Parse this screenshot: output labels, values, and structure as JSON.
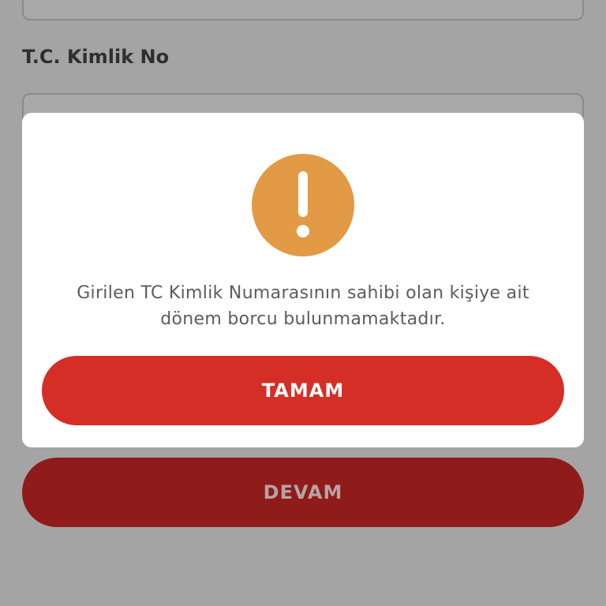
{
  "form": {
    "tc_label": "T.C. Kimlik No",
    "tc_value": "",
    "continue_label": "DEVAM"
  },
  "dialog": {
    "icon": "exclamation-icon",
    "message": "Girilen TC Kimlik Numarasının sahibi olan kişiye ait dönem borcu bulunmamaktadır.",
    "confirm_label": "TAMAM"
  },
  "colors": {
    "overlay_background": "#a4a4a4",
    "alert_icon": "#e39a44",
    "primary_button": "#d52e26",
    "dimmed_button": "#8f1b1b"
  }
}
